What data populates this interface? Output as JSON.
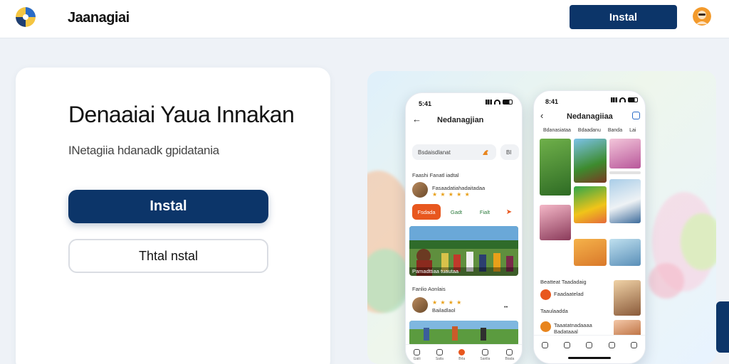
{
  "header": {
    "brand": "Jaanagiai",
    "install_label": "Instal",
    "logo_icon": "globe-icon",
    "avatar_icon": "user-avatar-icon"
  },
  "hero": {
    "title": "Denaaiai Yaua Innakan",
    "subtitle": "INetagiia hdanadk gpidatania",
    "primary_label": "Instal",
    "secondary_label": "Thtal nstal"
  },
  "phone_left": {
    "time": "5:41",
    "title": "Nedanagjian",
    "search_text": "Bsdaisdlanat",
    "search_side": "Bl",
    "section1": "Faashi Fanatl iadtal",
    "row1_text": "Fasaadatiahadaitadaa",
    "row1_stars": "★ ★ ★ ★ ★",
    "pills": [
      "Fsdada",
      "Gadt",
      "Fialt",
      ""
    ],
    "photo_caption": "Pamadttiaa tuautaa",
    "section2": "Fanlio Aonlais",
    "row2_stars": "★ ★ ★ ★",
    "row2_text": "Bailadlaol",
    "tabs": [
      "Gaili",
      "Saila",
      "Brla",
      "Sanlla",
      "Biada"
    ]
  },
  "phone_right": {
    "time": "8:41",
    "title": "Nedanagiiaa",
    "sub_tabs": [
      "Bdanasiataa",
      "Bdaadanu",
      "Banda",
      "Lai"
    ],
    "section": "Beatteat Taadadaig",
    "item1": "Faadaatelad",
    "item1_sub": "Taaulaadda",
    "item2": "Taaatatnadaaaa",
    "item2_sub": "Badataaal"
  },
  "colors": {
    "primary": "#0c3569",
    "accent": "#e8571e",
    "background": "#eef2f7"
  }
}
